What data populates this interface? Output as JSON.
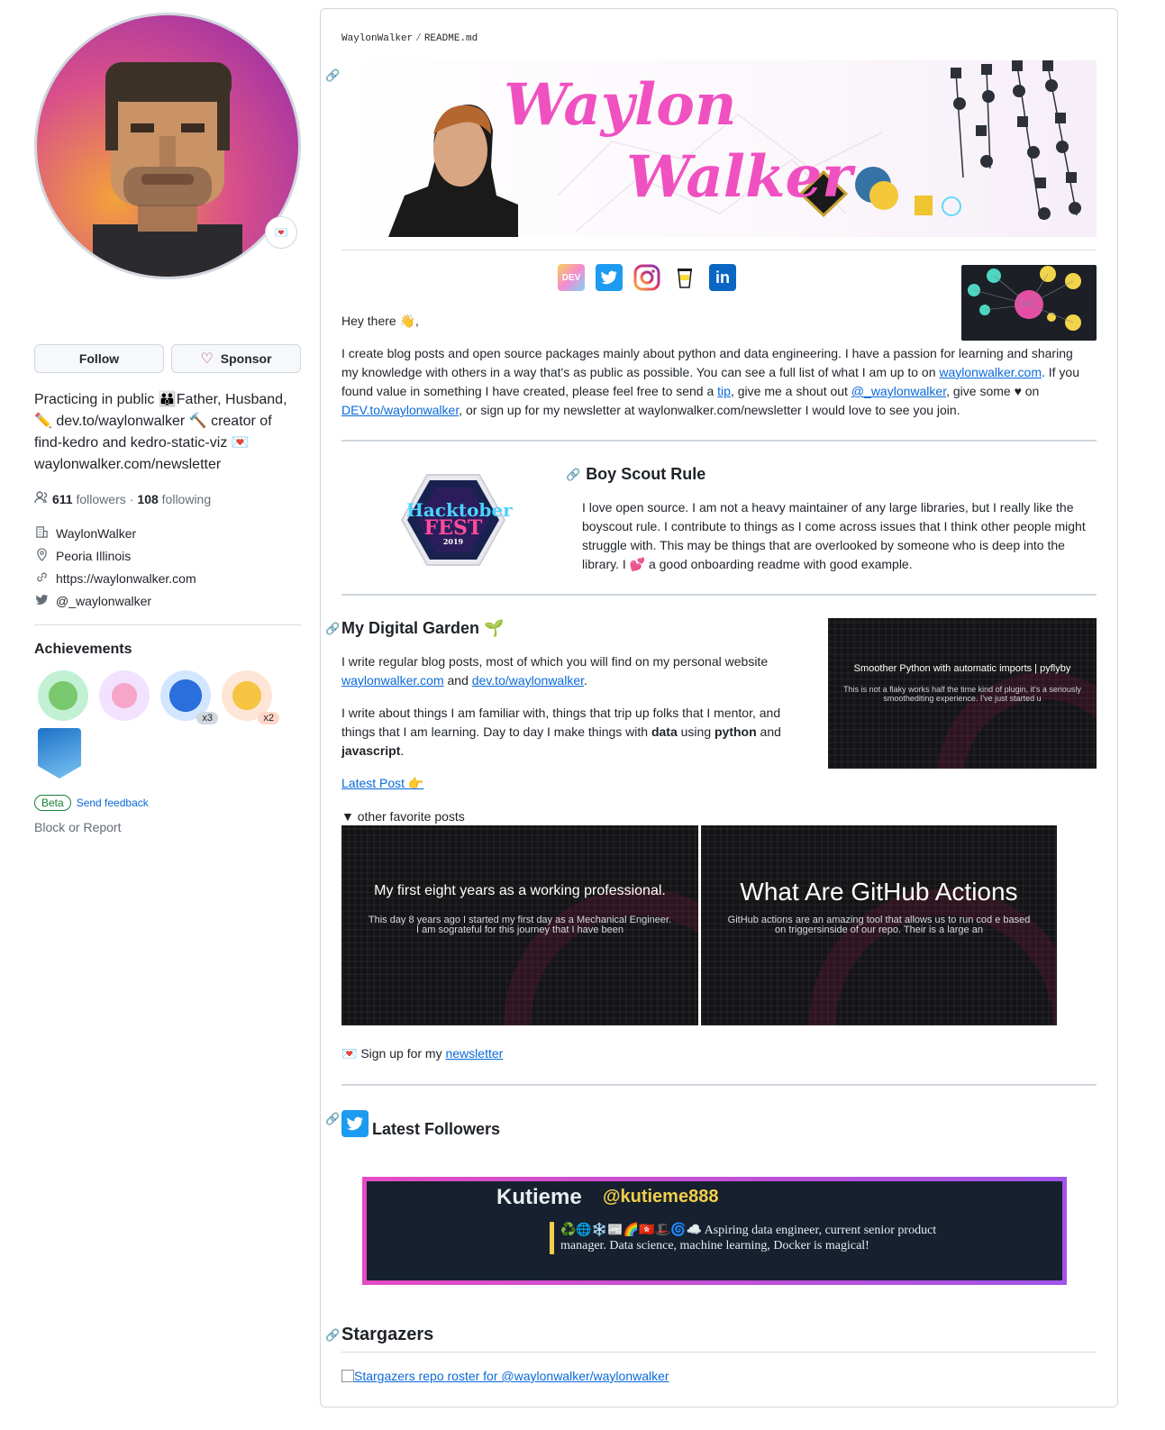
{
  "profile": {
    "follow_label": "Follow",
    "sponsor_label": "Sponsor",
    "bio_lines": [
      "Practicing in public 👪Father, Husband,",
      "✏️ dev.to/waylonwalker 🔨 creator of",
      "find-kedro and kedro-static-viz 💌",
      "waylonwalker.com/newsletter"
    ],
    "followers_count": "611",
    "followers_label": "followers",
    "following_count": "108",
    "following_label": "following",
    "separator": "·",
    "company": "WaylonWalker",
    "location": "Peoria Illinois",
    "website": "https://waylonwalker.com",
    "twitter": "@_waylonwalker",
    "achievements_title": "Achievements",
    "badge_counts": [
      "x3",
      "x2"
    ],
    "beta_label": "Beta",
    "feedback_label": "Send feedback",
    "block_label": "Block or Report"
  },
  "readme": {
    "breadcrumb_owner": "WaylonWalker",
    "breadcrumb_sep": "/",
    "breadcrumb_file": "README.md",
    "banner_title_1": "Waylon",
    "banner_title_2": "Walker",
    "greeting": "Hey there 👋,",
    "intro": {
      "t1": "I create blog posts and open source packages mainly about python and data engineering. I have a passion for learning and sharing my knowledge with others in a way that's as public as possible. You can see a full list of what I am up to on ",
      "l1": "waylonwalker.com",
      "t2": ". If you found value in something I have created, please feel free to send a ",
      "l2": "tip",
      "t3": ", give me a shout out ",
      "l3": "@_waylonwalker",
      "t4": ", give some ♥ on ",
      "l4": "DEV.to/waylonwalker",
      "t5": ", or sign up for my newsletter at waylonwalker.com/newsletter I would love to see you join."
    },
    "boy_scout": {
      "title": "Boy Scout Rule",
      "body": "I love open source. I am not a heavy maintainer of any large libraries, but I really like the boyscout rule. I contribute to things as I come across issues that I think other people might struggle with. This may be things that are overlooked by someone who is deep into the library. I 💕 a good onboarding readme with good example.",
      "hex_line1": "Hacktober",
      "hex_line2": "FEST",
      "hex_year": "2019"
    },
    "garden": {
      "title": "My Digital Garden 🌱",
      "p1_text": "I write regular blog posts, most of which you will find on my personal website ",
      "p1_link1": "waylonwalker.com",
      "p1_and": " and ",
      "p1_link2": "dev.to/waylonwalker",
      "p1_end": ".",
      "p2_a": "I write about things I am familiar with, things that trip up folks that I mentor, and things that I am learning. Day to day I make things with ",
      "p2_data": "data",
      "p2_b": " using ",
      "p2_python": "python",
      "p2_c": " and ",
      "p2_js": "javascript",
      "p2_d": ".",
      "latest_post": "Latest Post 👉",
      "card_title": "Smoother Python with automatic imports | pyflyby",
      "card_desc": "This is not a flaky works half the time kind of plugin, it's a seriously smoothediting experience.  I've just started u",
      "details_label": "other favorite posts",
      "post1_title": "My first eight years as a working professional.",
      "post1_desc": "This day 8 years ago I started my first day as a Mechanical Engineer. I am sograteful for this journey that I have been",
      "post2_title": "What Are GitHub Actions",
      "post2_desc": "GitHub actions are an amazing tool that allows us to run cod e based on triggersinside of our repo.  Their is a large an",
      "newsletter_prefix": "💌 Sign up for my ",
      "newsletter_link": "newsletter"
    },
    "followers": {
      "title": "Latest Followers",
      "name": "Kutieme",
      "handle": "@kutieme888",
      "bio_emoji": "♻️🌐❄️📰🌈🇭🇰🎩🌀☁️",
      "bio": "Aspiring data engineer, current senior product manager. Data science, machine learning, Docker is magical!"
    },
    "stargazers": {
      "title": "Stargazers",
      "alt": "Stargazers repo roster for @waylonwalker/waylonwalker"
    }
  },
  "colors": {
    "link": "#0969da",
    "banner_pink": "#f051c1",
    "heart": "#bf3989",
    "beta_green": "#1a7f37",
    "follower_bg": "#16202e",
    "handle_yellow": "#f2cf4a"
  },
  "icons": [
    "sponsor-heart-icon",
    "people-icon",
    "building-icon",
    "location-icon",
    "link-icon",
    "twitter-icon",
    "anchor-link-icon",
    "dev-icon",
    "instagram-icon",
    "coffee-icon",
    "linkedin-icon"
  ]
}
